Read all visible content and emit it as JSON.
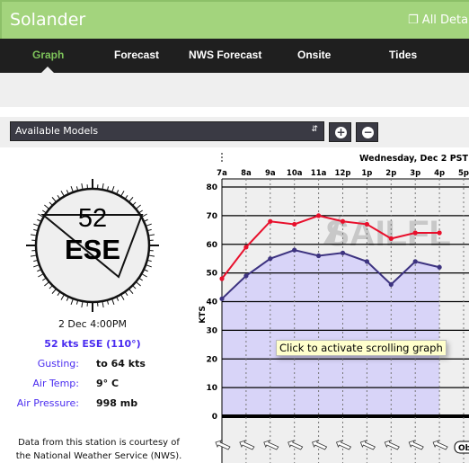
{
  "header": {
    "title": "Solander",
    "all_details": "All Details",
    "window_icon": "window-restore-icon"
  },
  "nav": {
    "tabs": [
      {
        "label": "Graph",
        "active": true
      },
      {
        "label": "Forecast"
      },
      {
        "label": "NWS Forecast"
      },
      {
        "label": "Onsite"
      },
      {
        "label": "Tides"
      }
    ]
  },
  "toolbar": {
    "models_select": "Available Models",
    "add_icon": "plus-circle-icon",
    "remove_icon": "minus-circle-icon"
  },
  "station": {
    "compass": {
      "speed": "52",
      "direction": "ESE",
      "degrees": 110
    },
    "time": "2 Dec 4:00PM",
    "summary": "52 kts ESE (110°)",
    "rows": [
      {
        "label": "Gusting",
        "value": "to 64 kts"
      },
      {
        "label": "Air Temp",
        "value": "9° C"
      },
      {
        "label": "Air Pressure",
        "value": "998 mb"
      }
    ],
    "courtesy_line1": "Data from this station is courtesy of",
    "courtesy_line2": "the National Weather Service (NWS)."
  },
  "tooltip": "Click to activate scrolling graph",
  "obs_label": "Ob",
  "chart_data": {
    "type": "line",
    "date_label": "Wednesday, Dec 2 PST",
    "ylabel": "KTS",
    "ylim": [
      0,
      80
    ],
    "yticks": [
      0,
      10,
      20,
      30,
      40,
      50,
      60,
      70,
      80
    ],
    "x": [
      "7a",
      "8a",
      "9a",
      "10a",
      "11a",
      "12p",
      "1p",
      "2p",
      "3p",
      "4p",
      "5p"
    ],
    "series": [
      {
        "key": "gust",
        "color": "#e8102c",
        "values": [
          48,
          59,
          68,
          67,
          70,
          68,
          67,
          62,
          64,
          64
        ]
      },
      {
        "key": "wind",
        "color": "#3d3380",
        "fill": "#d8d4f8",
        "values": [
          41,
          49,
          55,
          58,
          56,
          57,
          54,
          46,
          54,
          52
        ]
      }
    ],
    "wind_direction_arrows": "ESE",
    "watermark": "SAILFLOW"
  }
}
